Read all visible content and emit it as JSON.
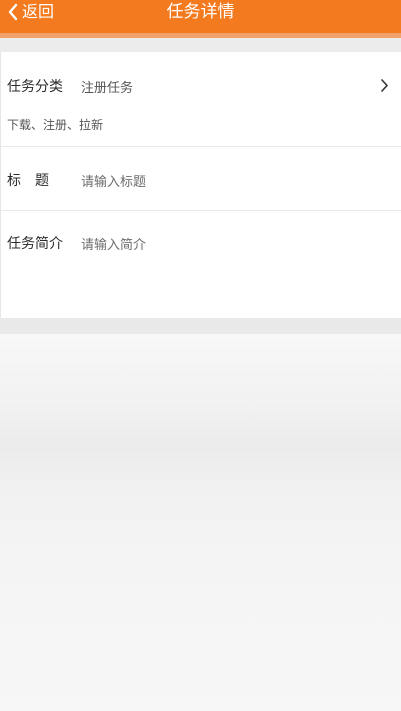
{
  "header": {
    "back_label": "返回",
    "title": "任务详情",
    "background": "#f37a1f"
  },
  "form": {
    "category": {
      "label": "任务分类",
      "value": "注册任务",
      "hint": "下载、注册、拉新"
    },
    "title_field": {
      "label": "标　题",
      "placeholder": "请输入标题"
    },
    "intro_field": {
      "label": "任务简介",
      "placeholder": "请输入简介"
    }
  },
  "icons": {
    "back": "chevron-left-icon",
    "category_arrow": "chevron-right-icon"
  }
}
